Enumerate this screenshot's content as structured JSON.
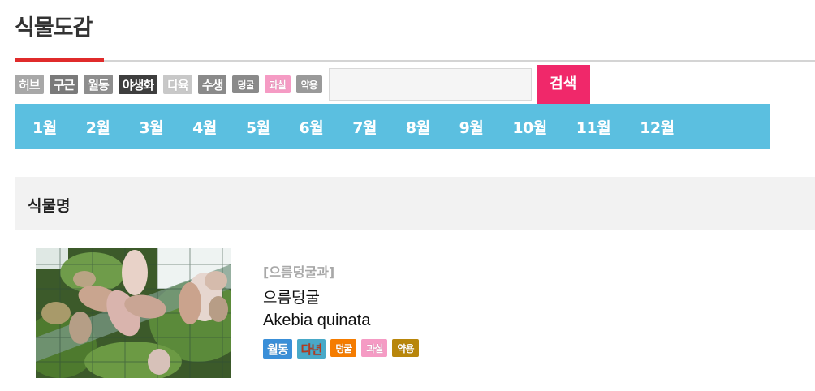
{
  "page": {
    "title": "식물도감"
  },
  "filters": {
    "tags": [
      {
        "label": "허브",
        "color": "#a8a8a8",
        "small": false
      },
      {
        "label": "구근",
        "color": "#7a7a7a",
        "small": false
      },
      {
        "label": "월동",
        "color": "#8e8e8e",
        "small": false
      },
      {
        "label": "야생화",
        "color": "#3e3e3e",
        "small": false
      },
      {
        "label": "다육",
        "color": "#c8c8c8",
        "small": false
      },
      {
        "label": "수생",
        "color": "#8a8a8a",
        "small": false
      },
      {
        "label": "덩굴",
        "color": "#8a8a8a",
        "small": true
      },
      {
        "label": "과실",
        "color": "#f59bc4",
        "small": true
      },
      {
        "label": "약용",
        "color": "#9a9a9a",
        "small": true
      }
    ],
    "search": {
      "value": "",
      "placeholder": "",
      "button_label": "검색"
    }
  },
  "months": [
    "1월",
    "2월",
    "3월",
    "4월",
    "5월",
    "6월",
    "7월",
    "8월",
    "9월",
    "10월",
    "11월",
    "12월"
  ],
  "section": {
    "title": "식물명"
  },
  "plants": [
    {
      "family": "[으름덩굴과]",
      "name_kr": "으름덩굴",
      "name_sci": "Akebia quinata",
      "tags": [
        {
          "label": "월동",
          "color": "#3a8fd8",
          "text_color": "#ffffff",
          "small": false
        },
        {
          "label": "다년",
          "color": "#49a9c8",
          "text_color": "#b53a1e",
          "small": false
        },
        {
          "label": "덩굴",
          "color": "#f57c00",
          "text_color": "#ffffff",
          "small": true
        },
        {
          "label": "과실",
          "color": "#f59bc4",
          "text_color": "#ffffff",
          "small": true
        },
        {
          "label": "약용",
          "color": "#b8860b",
          "text_color": "#ffffff",
          "small": true
        }
      ]
    }
  ],
  "colors": {
    "accent": "#e02b2b",
    "search_button": "#f0286a",
    "month_bar": "#5bbfe0"
  }
}
